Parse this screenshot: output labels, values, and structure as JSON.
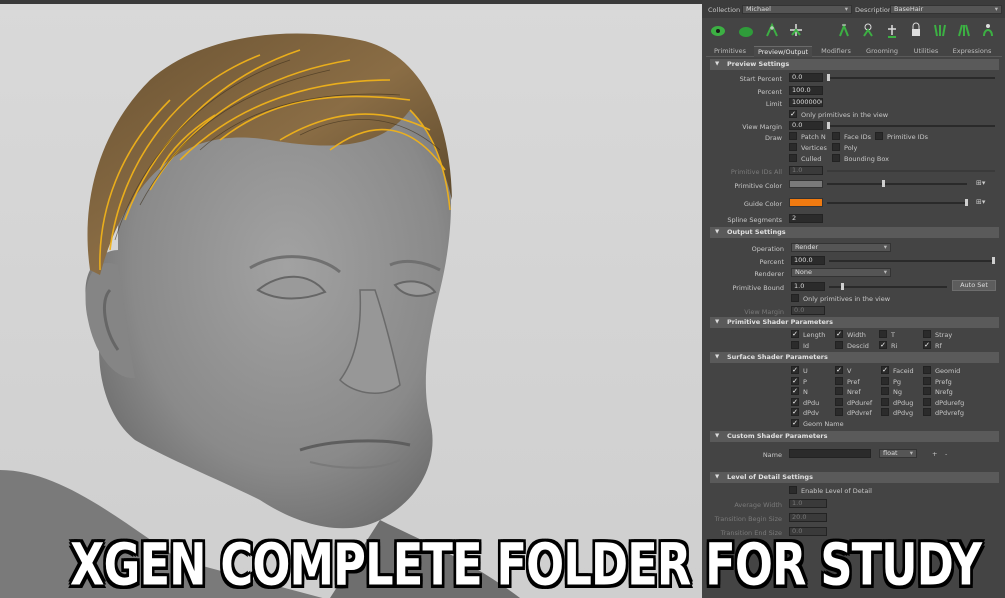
{
  "caption": "XGEN COMPLETE FOLDER FOR STUDY",
  "header": {
    "collection_label": "Collection",
    "collection_value": "Michael",
    "description_label": "Description",
    "description_value": "BaseHair"
  },
  "tabs": [
    "Primitives",
    "Preview/Output",
    "Modifiers",
    "Grooming",
    "Utilities",
    "Expressions"
  ],
  "active_tab": "Preview/Output",
  "preview": {
    "title": "Preview Settings",
    "start_percent_label": "Start Percent",
    "start_percent": "0.0",
    "percent_label": "Percent",
    "percent": "100.0",
    "limit_label": "Limit",
    "limit": "100000000",
    "only_primitives": "Only primitives in the view",
    "view_margin_label": "View Margin",
    "view_margin": "0.0",
    "draw_label": "Draw",
    "draw_options": [
      "Patch N",
      "Face IDs",
      "Primitive IDs",
      "Vertices",
      "Poly",
      "Culled",
      "Bounding Box"
    ],
    "primitive_ids_all_label": "Primitive IDs All",
    "primitive_ids_all": "1.0",
    "primitive_color_label": "Primitive Color",
    "guide_color_label": "Guide Color",
    "spline_segments_label": "Spline Segments",
    "spline_segments": "2"
  },
  "output": {
    "title": "Output Settings",
    "operation_label": "Operation",
    "operation": "Render",
    "percent_label": "Percent",
    "percent": "100.0",
    "renderer_label": "Renderer",
    "renderer": "None",
    "primitive_bound_label": "Primitive Bound",
    "primitive_bound": "1.0",
    "auto_set": "Auto Set",
    "only_primitives": "Only primitives in the view",
    "view_margin_label": "View Margin",
    "view_margin": "0.0"
  },
  "primitive_shader": {
    "title": "Primitive Shader Parameters",
    "items": [
      "Length",
      "Width",
      "T",
      "Stray",
      "Id",
      "Descid",
      "Ri",
      "Rf"
    ]
  },
  "surface_shader": {
    "title": "Surface Shader Parameters",
    "items": [
      "U",
      "V",
      "Faceid",
      "Geomid",
      "P",
      "Pref",
      "Pg",
      "Prefg",
      "N",
      "Nref",
      "Ng",
      "Nrefg",
      "dPdu",
      "dPduref",
      "dPdug",
      "dPdurefg",
      "dPdv",
      "dPdvref",
      "dPdvg",
      "dPdvrefg",
      "Geom Name"
    ]
  },
  "custom_shader": {
    "title": "Custom Shader Parameters",
    "name_label": "Name",
    "type": "float",
    "plus": "+",
    "minus": "-"
  },
  "lod": {
    "title": "Level of Detail Settings",
    "enable": "Enable Level of Detail",
    "average_width_label": "Average Width",
    "average_width": "1.0",
    "begin_size_label": "Transition Begin Size",
    "begin_size": "20.0",
    "end_size_label": "Transition End Size",
    "end_size": "0.0"
  },
  "colors": {
    "guide": "#f07a10",
    "primitive": "#7a7a7a",
    "hair_guides": "#f0b21a",
    "panel_bg": "#444444"
  },
  "icons": [
    "guide-tool-icon",
    "brush-icon",
    "add-guide-icon",
    "move-guide-icon",
    "sculpt-icon",
    "cut-icon",
    "attach-icon",
    "lock-icon",
    "comb-icon",
    "density-icon",
    "rebuild-icon",
    "flip-icon",
    "bend-icon",
    "relax-icon"
  ]
}
